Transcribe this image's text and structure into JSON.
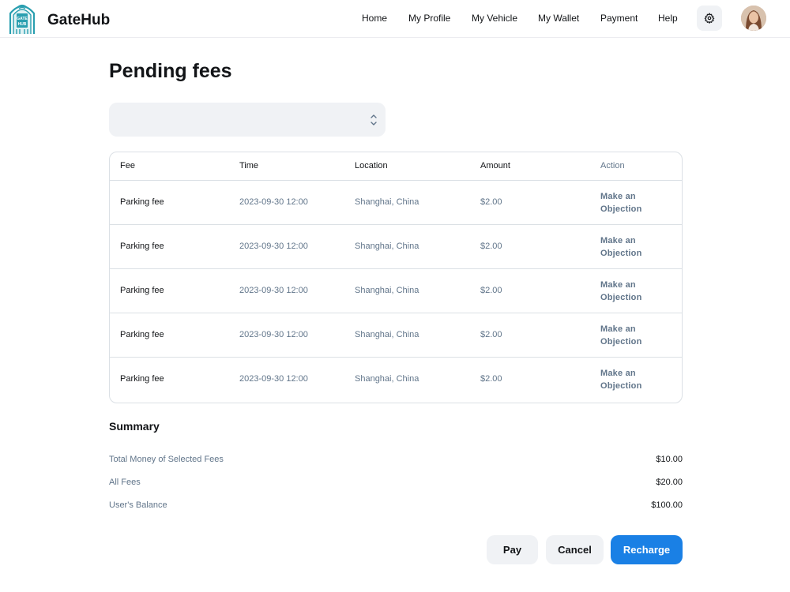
{
  "header": {
    "brand": "GateHub",
    "logo_text": "GATE HUB",
    "nav": [
      "Home",
      "My Profile",
      "My Vehicle",
      "My Wallet",
      "Payment",
      "Help"
    ],
    "settings_icon": "gear-icon",
    "avatar_icon": "user-avatar"
  },
  "page": {
    "title": "Pending fees"
  },
  "filter": {
    "value": "",
    "chevron_icon": "chevron-up-down-icon"
  },
  "table": {
    "headers": {
      "fee": "Fee",
      "time": "Time",
      "location": "Location",
      "amount": "Amount",
      "action": "Action"
    },
    "rows": [
      {
        "fee": "Parking fee",
        "time": "2023-09-30 12:00",
        "location": "Shanghai, China",
        "amount": "$2.00",
        "action": "Make an Objection"
      },
      {
        "fee": "Parking fee",
        "time": "2023-09-30 12:00",
        "location": "Shanghai, China",
        "amount": "$2.00",
        "action": "Make an Objection"
      },
      {
        "fee": "Parking fee",
        "time": "2023-09-30 12:00",
        "location": "Shanghai, China",
        "amount": "$2.00",
        "action": "Make an Objection"
      },
      {
        "fee": "Parking fee",
        "time": "2023-09-30 12:00",
        "location": "Shanghai, China",
        "amount": "$2.00",
        "action": "Make an Objection"
      },
      {
        "fee": "Parking fee",
        "time": "2023-09-30 12:00",
        "location": "Shanghai, China",
        "amount": "$2.00",
        "action": "Make an Objection"
      }
    ]
  },
  "summary": {
    "title": "Summary",
    "items": [
      {
        "label": "Total Money of Selected Fees",
        "value": "$10.00"
      },
      {
        "label": "All Fees",
        "value": "$20.00"
      },
      {
        "label": "User's Balance",
        "value": "$100.00"
      }
    ]
  },
  "buttons": {
    "pay": "Pay",
    "cancel": "Cancel",
    "recharge": "Recharge"
  },
  "colors": {
    "accent": "#1a80e5",
    "muted_text": "#61758a",
    "border": "#dbe0e5",
    "surface": "#f0f2f5",
    "logo": "#2a9fb0"
  }
}
